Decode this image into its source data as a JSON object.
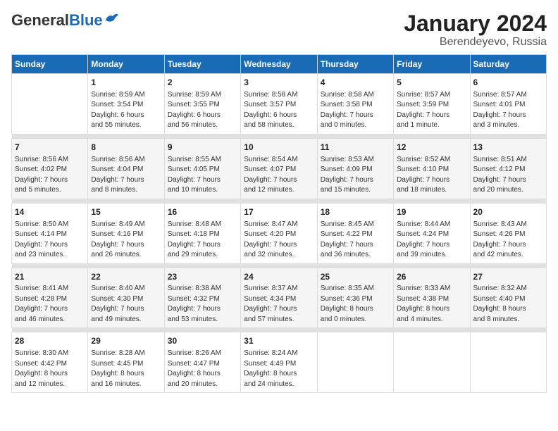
{
  "logo": {
    "general": "General",
    "blue": "Blue"
  },
  "title": "January 2024",
  "subtitle": "Berendeyevo, Russia",
  "days": [
    "Sunday",
    "Monday",
    "Tuesday",
    "Wednesday",
    "Thursday",
    "Friday",
    "Saturday"
  ],
  "weeks": [
    [
      {
        "date": "",
        "info": ""
      },
      {
        "date": "1",
        "info": "Sunrise: 8:59 AM\nSunset: 3:54 PM\nDaylight: 6 hours\nand 55 minutes."
      },
      {
        "date": "2",
        "info": "Sunrise: 8:59 AM\nSunset: 3:55 PM\nDaylight: 6 hours\nand 56 minutes."
      },
      {
        "date": "3",
        "info": "Sunrise: 8:58 AM\nSunset: 3:57 PM\nDaylight: 6 hours\nand 58 minutes."
      },
      {
        "date": "4",
        "info": "Sunrise: 8:58 AM\nSunset: 3:58 PM\nDaylight: 7 hours\nand 0 minutes."
      },
      {
        "date": "5",
        "info": "Sunrise: 8:57 AM\nSunset: 3:59 PM\nDaylight: 7 hours\nand 1 minute."
      },
      {
        "date": "6",
        "info": "Sunrise: 8:57 AM\nSunset: 4:01 PM\nDaylight: 7 hours\nand 3 minutes."
      }
    ],
    [
      {
        "date": "7",
        "info": "Sunrise: 8:56 AM\nSunset: 4:02 PM\nDaylight: 7 hours\nand 5 minutes."
      },
      {
        "date": "8",
        "info": "Sunrise: 8:56 AM\nSunset: 4:04 PM\nDaylight: 7 hours\nand 8 minutes."
      },
      {
        "date": "9",
        "info": "Sunrise: 8:55 AM\nSunset: 4:05 PM\nDaylight: 7 hours\nand 10 minutes."
      },
      {
        "date": "10",
        "info": "Sunrise: 8:54 AM\nSunset: 4:07 PM\nDaylight: 7 hours\nand 12 minutes."
      },
      {
        "date": "11",
        "info": "Sunrise: 8:53 AM\nSunset: 4:09 PM\nDaylight: 7 hours\nand 15 minutes."
      },
      {
        "date": "12",
        "info": "Sunrise: 8:52 AM\nSunset: 4:10 PM\nDaylight: 7 hours\nand 18 minutes."
      },
      {
        "date": "13",
        "info": "Sunrise: 8:51 AM\nSunset: 4:12 PM\nDaylight: 7 hours\nand 20 minutes."
      }
    ],
    [
      {
        "date": "14",
        "info": "Sunrise: 8:50 AM\nSunset: 4:14 PM\nDaylight: 7 hours\nand 23 minutes."
      },
      {
        "date": "15",
        "info": "Sunrise: 8:49 AM\nSunset: 4:16 PM\nDaylight: 7 hours\nand 26 minutes."
      },
      {
        "date": "16",
        "info": "Sunrise: 8:48 AM\nSunset: 4:18 PM\nDaylight: 7 hours\nand 29 minutes."
      },
      {
        "date": "17",
        "info": "Sunrise: 8:47 AM\nSunset: 4:20 PM\nDaylight: 7 hours\nand 32 minutes."
      },
      {
        "date": "18",
        "info": "Sunrise: 8:45 AM\nSunset: 4:22 PM\nDaylight: 7 hours\nand 36 minutes."
      },
      {
        "date": "19",
        "info": "Sunrise: 8:44 AM\nSunset: 4:24 PM\nDaylight: 7 hours\nand 39 minutes."
      },
      {
        "date": "20",
        "info": "Sunrise: 8:43 AM\nSunset: 4:26 PM\nDaylight: 7 hours\nand 42 minutes."
      }
    ],
    [
      {
        "date": "21",
        "info": "Sunrise: 8:41 AM\nSunset: 4:28 PM\nDaylight: 7 hours\nand 46 minutes."
      },
      {
        "date": "22",
        "info": "Sunrise: 8:40 AM\nSunset: 4:30 PM\nDaylight: 7 hours\nand 49 minutes."
      },
      {
        "date": "23",
        "info": "Sunrise: 8:38 AM\nSunset: 4:32 PM\nDaylight: 7 hours\nand 53 minutes."
      },
      {
        "date": "24",
        "info": "Sunrise: 8:37 AM\nSunset: 4:34 PM\nDaylight: 7 hours\nand 57 minutes."
      },
      {
        "date": "25",
        "info": "Sunrise: 8:35 AM\nSunset: 4:36 PM\nDaylight: 8 hours\nand 0 minutes."
      },
      {
        "date": "26",
        "info": "Sunrise: 8:33 AM\nSunset: 4:38 PM\nDaylight: 8 hours\nand 4 minutes."
      },
      {
        "date": "27",
        "info": "Sunrise: 8:32 AM\nSunset: 4:40 PM\nDaylight: 8 hours\nand 8 minutes."
      }
    ],
    [
      {
        "date": "28",
        "info": "Sunrise: 8:30 AM\nSunset: 4:42 PM\nDaylight: 8 hours\nand 12 minutes."
      },
      {
        "date": "29",
        "info": "Sunrise: 8:28 AM\nSunset: 4:45 PM\nDaylight: 8 hours\nand 16 minutes."
      },
      {
        "date": "30",
        "info": "Sunrise: 8:26 AM\nSunset: 4:47 PM\nDaylight: 8 hours\nand 20 minutes."
      },
      {
        "date": "31",
        "info": "Sunrise: 8:24 AM\nSunset: 4:49 PM\nDaylight: 8 hours\nand 24 minutes."
      },
      {
        "date": "",
        "info": ""
      },
      {
        "date": "",
        "info": ""
      },
      {
        "date": "",
        "info": ""
      }
    ]
  ]
}
